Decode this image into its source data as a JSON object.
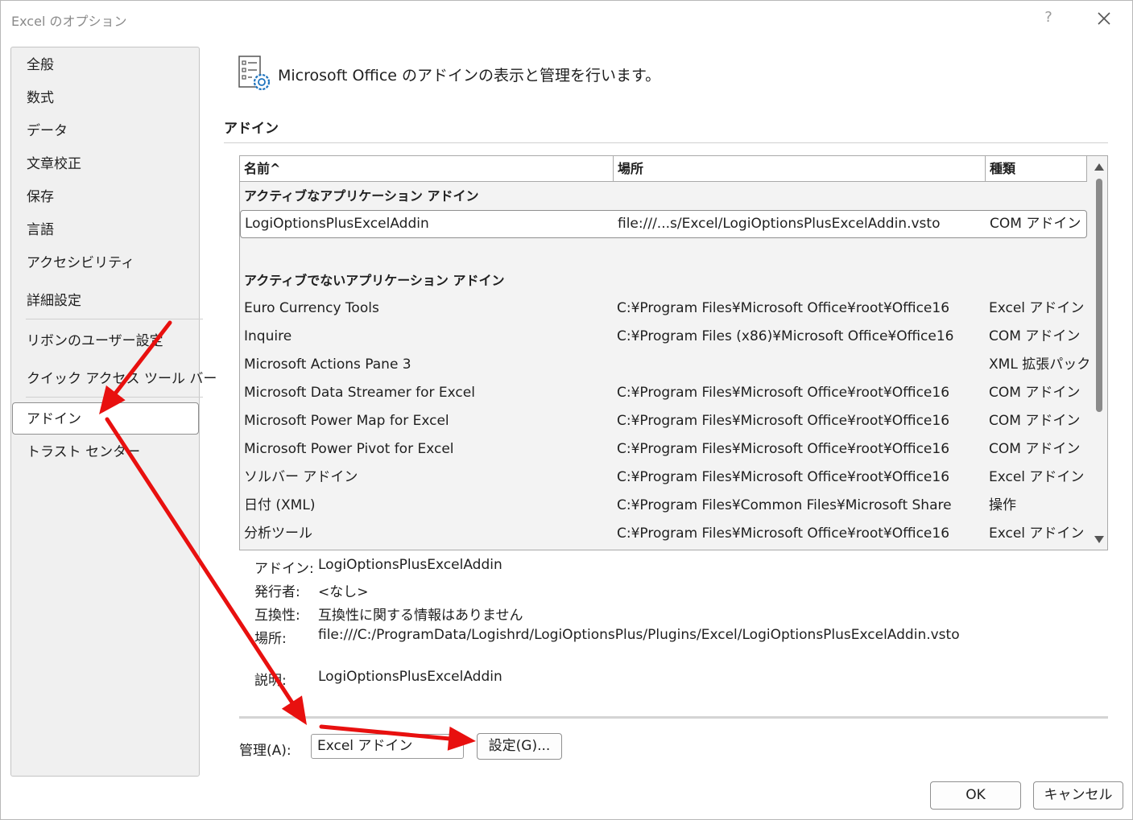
{
  "window": {
    "title": "Excel のオプション",
    "help": "?"
  },
  "sidebar": {
    "items": [
      {
        "label": "全般"
      },
      {
        "label": "数式"
      },
      {
        "label": "データ"
      },
      {
        "label": "文章校正"
      },
      {
        "label": "保存"
      },
      {
        "label": "言語"
      },
      {
        "label": "アクセシビリティ"
      },
      {
        "label": "詳細設定"
      },
      {
        "label": "リボンのユーザー設定"
      },
      {
        "label": "クイック アクセス ツール バー"
      },
      {
        "label": "アドイン"
      },
      {
        "label": "トラスト センター"
      }
    ],
    "selected": "アドイン"
  },
  "main": {
    "header": "Microsoft Office のアドインの表示と管理を行います。",
    "section_title": "アドイン",
    "table": {
      "columns": {
        "name": "名前^",
        "location": "場所",
        "type": "種類"
      },
      "active_group": "アクティブなアプリケーション アドイン",
      "active_rows": [
        {
          "name": "LogiOptionsPlusExcelAddin",
          "location": "file:///...s/Excel/LogiOptionsPlusExcelAddin.vsto",
          "type": "COM アドイン"
        }
      ],
      "inactive_group": "アクティブでないアプリケーション アドイン",
      "inactive_rows": [
        {
          "name": "Euro Currency Tools",
          "location": "C:¥Program Files¥Microsoft Office¥root¥Office16",
          "type": "Excel アドイン"
        },
        {
          "name": "Inquire",
          "location": "C:¥Program Files (x86)¥Microsoft Office¥Office16",
          "type": "COM アドイン"
        },
        {
          "name": "Microsoft Actions Pane 3",
          "location": "",
          "type": "XML 拡張パック"
        },
        {
          "name": "Microsoft Data Streamer for Excel",
          "location": "C:¥Program Files¥Microsoft Office¥root¥Office16",
          "type": "COM アドイン"
        },
        {
          "name": "Microsoft Power Map for Excel",
          "location": "C:¥Program Files¥Microsoft Office¥root¥Office16",
          "type": "COM アドイン"
        },
        {
          "name": "Microsoft Power Pivot for Excel",
          "location": "C:¥Program Files¥Microsoft Office¥root¥Office16",
          "type": "COM アドイン"
        },
        {
          "name": "ソルバー アドイン",
          "location": "C:¥Program Files¥Microsoft Office¥root¥Office16",
          "type": "Excel アドイン"
        },
        {
          "name": "日付 (XML)",
          "location": "C:¥Program Files¥Common Files¥Microsoft Share",
          "type": "操作"
        },
        {
          "name": "分析ツール",
          "location": "C:¥Program Files¥Microsoft Office¥root¥Office16",
          "type": "Excel アドイン"
        }
      ]
    },
    "details": {
      "addin_label": "アドイン:",
      "addin_value": "LogiOptionsPlusExcelAddin",
      "publisher_label": "発行者:",
      "publisher_value": "<なし>",
      "compat_label": "互換性:",
      "compat_value": "互換性に関する情報はありません",
      "location_label": "場所:",
      "location_value": "file:///C:/ProgramData/Logishrd/LogiOptionsPlus/Plugins/Excel/LogiOptionsPlusExcelAddin.vsto",
      "desc_label": "説明:",
      "desc_value": "LogiOptionsPlusExcelAddin"
    },
    "manage": {
      "label": "管理(A):",
      "selected": "Excel アドイン",
      "go_button": "設定(G)..."
    }
  },
  "footer": {
    "ok": "OK",
    "cancel": "キャンセル"
  },
  "colors": {
    "annotation_arrow": "#e8100f",
    "sidebar_bg": "#f0f0f0",
    "table_bg": "#f3f3f3"
  }
}
